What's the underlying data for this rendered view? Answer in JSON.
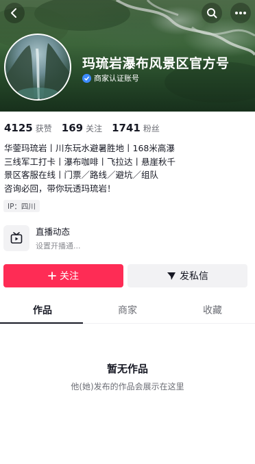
{
  "header": {
    "account_name": "玛琉岩瀑布风景区官方号",
    "verify_text": "商家认证账号"
  },
  "icons": {
    "back": "back-arrow-icon",
    "search": "search-icon",
    "more": "more-dots-icon",
    "verified": "verified-badge-icon",
    "live": "live-tv-icon",
    "follow": "plus-icon",
    "message": "send-icon"
  },
  "stats": [
    {
      "value": "4125",
      "label": "获赞"
    },
    {
      "value": "169",
      "label": "关注"
    },
    {
      "value": "1741",
      "label": "粉丝"
    }
  ],
  "bio": [
    "华蓥玛琉岩丨川东玩水避暑胜地丨168米高瀑",
    "三线军工打卡丨瀑布咖啡丨飞拉达丨悬崖秋千",
    "景区客服在线丨门票／路线／避坑／组队",
    "咨询必回，带你玩透玛琉岩！"
  ],
  "ip_location": "IP：四川",
  "live": {
    "title": "直播动态",
    "subtitle": "设置开播通..."
  },
  "actions": {
    "follow_label": "关注",
    "message_label": "发私信"
  },
  "tabs": [
    {
      "label": "作品",
      "active": true
    },
    {
      "label": "商家",
      "active": false
    },
    {
      "label": "收藏",
      "active": false
    }
  ],
  "empty_state": {
    "title": "暂无作品",
    "subtitle": "他(她)发布的作品会展示在这里"
  },
  "colors": {
    "accent": "#fe2c55",
    "verified": "#3d8bff",
    "secondary_bg": "#f2f2f4"
  }
}
